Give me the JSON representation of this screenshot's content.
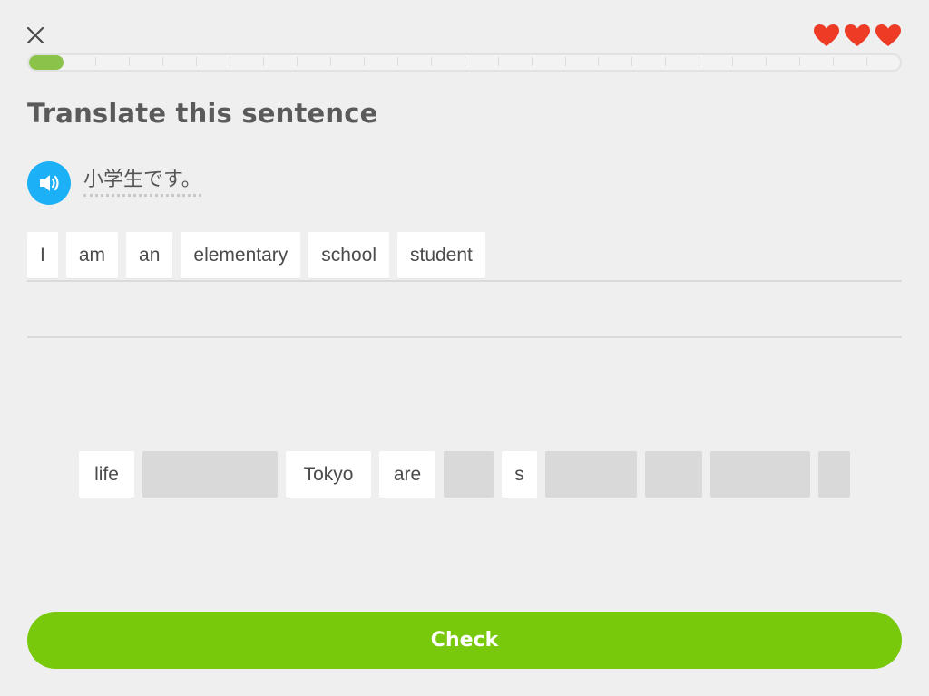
{
  "header": {
    "close_icon": "close-icon",
    "hearts": [
      {
        "icon": "heart-icon",
        "color": "#ee3b25"
      },
      {
        "icon": "heart-icon",
        "color": "#ee3b25"
      },
      {
        "icon": "heart-icon",
        "color": "#ee3b25"
      }
    ],
    "progress": {
      "fraction": 0.04,
      "segments": 26,
      "fill_color": "#8bc34a"
    }
  },
  "exercise": {
    "title": "Translate this sentence",
    "speaker_icon": "speaker-icon",
    "prompt": "小学生です。",
    "answer_tiles": [
      "I",
      "am",
      "an",
      "elementary",
      "school",
      "student"
    ],
    "word_bank": [
      {
        "type": "word",
        "text": "life"
      },
      {
        "type": "used"
      },
      {
        "type": "word",
        "text": "Tokyo"
      },
      {
        "type": "word",
        "text": "are"
      },
      {
        "type": "used"
      },
      {
        "type": "word",
        "text": "s"
      },
      {
        "type": "used"
      },
      {
        "type": "used"
      },
      {
        "type": "used"
      },
      {
        "type": "used"
      }
    ]
  },
  "footer": {
    "check_label": "Check",
    "accent": "#78c80c"
  }
}
